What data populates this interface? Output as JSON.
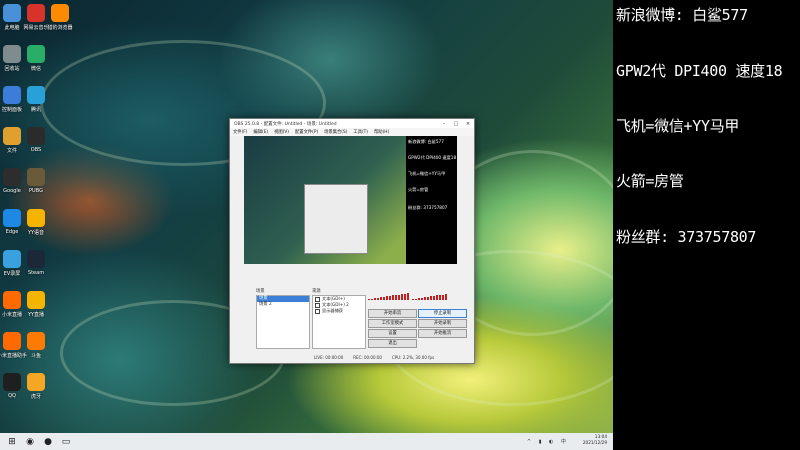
{
  "desktop": {
    "icons_col1": [
      {
        "label": "此电脑",
        "icon": "computer-icon",
        "color": "#4a90d9"
      },
      {
        "label": "回收站",
        "icon": "recycle-bin-icon",
        "color": "#7f8c8d"
      },
      {
        "label": "控制面板",
        "icon": "control-panel-icon",
        "color": "#3b7dd8"
      },
      {
        "label": "文件",
        "icon": "folder-icon",
        "color": "#e0a030"
      },
      {
        "label": "Google",
        "icon": "chrome-icon",
        "color": "#2d2d2d"
      },
      {
        "label": "Edge",
        "icon": "edge-icon",
        "color": "#1e88e5"
      },
      {
        "label": "EV录屏",
        "icon": "recorder-icon",
        "color": "#3aa0e0"
      },
      {
        "label": "小米直播",
        "icon": "mi-icon",
        "color": "#ff6a00"
      },
      {
        "label": "小米直播助手",
        "icon": "mi-assistant-icon",
        "color": "#ff6a00"
      },
      {
        "label": "QQ",
        "icon": "qq-icon",
        "color": "#1f1f1f"
      }
    ],
    "icons_col2": [
      {
        "label": "网易云音乐",
        "icon": "netease-music-icon",
        "color": "#d8332b"
      },
      {
        "label": "微信",
        "icon": "wechat-icon",
        "color": "#2aae67"
      },
      {
        "label": "腾讯",
        "icon": "tencent-icon",
        "color": "#2aa0d8"
      },
      {
        "label": "OBS",
        "icon": "obs-icon",
        "color": "#2b2b2b"
      },
      {
        "label": "PUBG",
        "icon": "game-icon",
        "color": "#6b5a3a"
      },
      {
        "label": "YY语音",
        "icon": "yy-icon",
        "color": "#f5b400"
      },
      {
        "label": "Steam",
        "icon": "steam-icon",
        "color": "#1b2838"
      },
      {
        "label": "YY直播",
        "icon": "yy-live-icon",
        "color": "#f5b400"
      },
      {
        "label": "斗鱼",
        "icon": "douyu-icon",
        "color": "#ff7a00"
      },
      {
        "label": "虎牙",
        "icon": "huya-icon",
        "color": "#f5a623"
      }
    ],
    "icons_col3": [
      {
        "label": "猎豹浏览器",
        "icon": "browser-icon",
        "color": "#ff8a00"
      }
    ]
  },
  "obs": {
    "title": "OBS 25.0.8 - 配置文件: Untitled - 场景: Untitled",
    "menu": [
      "文件(F)",
      "编辑(E)",
      "视图(V)",
      "配置文件(P)",
      "场景集合(S)",
      "工具(T)",
      "帮助(H)"
    ],
    "overlay_lines": [
      "新浪微博: 白鲨577",
      "GPW2代 DPI400 速度18",
      "飞机=微信+YY马甲",
      "火箭=房管",
      "粉丝群: 373757807"
    ],
    "scenes_header": "场景",
    "sources_header": "来源",
    "scenes": [
      "场景",
      "场景 2"
    ],
    "sources": [
      "文本(GDI+)",
      "文本(GDI+) 2",
      "显示器捕获"
    ],
    "buttons": [
      "开始串流",
      "停止录制",
      "工作室模式",
      "设置",
      "退出",
      "开始录制",
      "开始推流"
    ],
    "status": [
      "LIVE: 00:00:00",
      "REC: 00:00:00",
      "CPU: 2.2%, 30.00 fps"
    ]
  },
  "side_panel": {
    "lines": [
      "新浪微博: 白鲨577",
      "GPW2代 DPI400 速度18",
      "飞机=微信+YY马甲",
      "火箭=房管",
      "粉丝群: 373757807"
    ]
  },
  "taskbar": {
    "items": [
      {
        "icon": "windows-start-icon",
        "glyph": "⊞"
      },
      {
        "icon": "netease-music-icon",
        "glyph": "◉"
      },
      {
        "icon": "obs-icon",
        "glyph": "●"
      },
      {
        "icon": "file-explorer-icon",
        "glyph": "▭"
      }
    ],
    "time": "13:04",
    "date": "2021/12/29"
  }
}
